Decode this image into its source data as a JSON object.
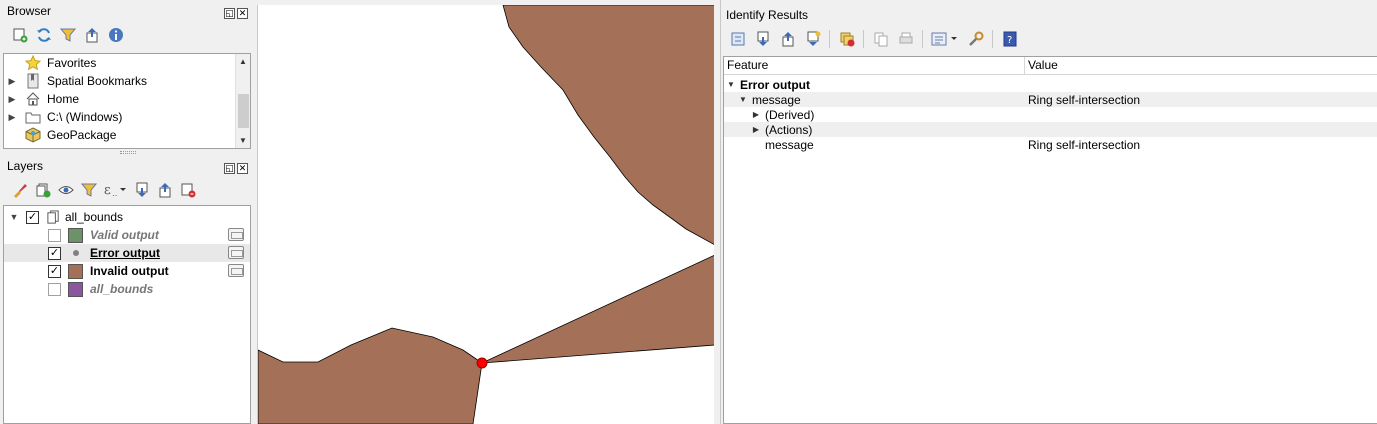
{
  "browser": {
    "title": "Browser",
    "items": [
      {
        "label": "Favorites",
        "icon": "star-icon",
        "expandable": false
      },
      {
        "label": "Spatial Bookmarks",
        "icon": "bookmark-icon",
        "expandable": true
      },
      {
        "label": "Home",
        "icon": "home-icon",
        "expandable": true
      },
      {
        "label": "C:\\ (Windows)",
        "icon": "folder-icon",
        "expandable": true
      },
      {
        "label": "GeoPackage",
        "icon": "geopackage-icon",
        "expandable": false
      }
    ]
  },
  "layers": {
    "title": "Layers",
    "group": {
      "label": "all_bounds",
      "checked": true
    },
    "items": [
      {
        "label": "Valid output",
        "checked": false,
        "color": "#6b9367",
        "visible": false
      },
      {
        "label": "Error output",
        "checked": true,
        "color": "#808080",
        "visible": true,
        "selected": true
      },
      {
        "label": "Invalid output",
        "checked": true,
        "color": "#a47158",
        "visible": true
      },
      {
        "label": "all_bounds",
        "checked": false,
        "color": "#8b55a0",
        "visible": false
      }
    ]
  },
  "map": {
    "polygon_fill": "#a47158",
    "error_point_color": "#ff0000"
  },
  "identify": {
    "title": "Identify Results",
    "columns": {
      "feature": "Feature",
      "value": "Value"
    },
    "rows": [
      {
        "feature": "Error output",
        "value": "",
        "bold": true,
        "expander": "open"
      },
      {
        "feature": "message",
        "value": "Ring self-intersection",
        "expander": "open"
      },
      {
        "feature": "(Derived)",
        "value": "",
        "expander": "closed"
      },
      {
        "feature": "(Actions)",
        "value": "",
        "expander": "closed"
      },
      {
        "feature": "message",
        "value": "Ring self-intersection",
        "expander": "none"
      }
    ]
  }
}
